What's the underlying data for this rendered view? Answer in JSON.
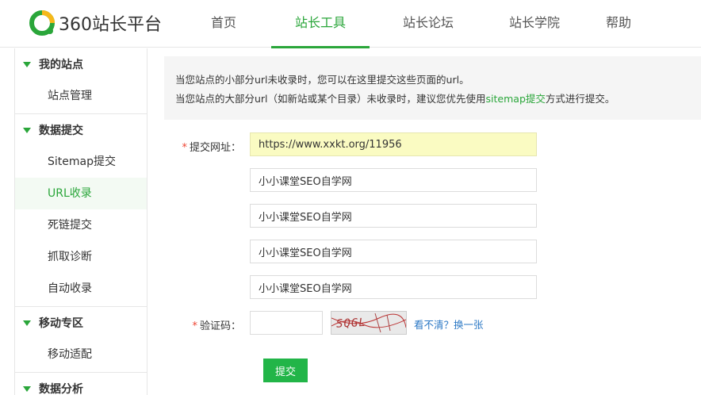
{
  "brand": {
    "name": "360站长平台",
    "accent": "#2aa63a"
  },
  "nav": {
    "items": [
      {
        "label": "首页",
        "active": false
      },
      {
        "label": "站长工具",
        "active": true
      },
      {
        "label": "站长论坛",
        "active": false
      },
      {
        "label": "站长学院",
        "active": false
      },
      {
        "label": "帮助",
        "active": false
      }
    ]
  },
  "sidebar": {
    "groups": [
      {
        "title": "我的站点",
        "items": [
          {
            "label": "站点管理",
            "active": false
          }
        ]
      },
      {
        "title": "数据提交",
        "items": [
          {
            "label": "Sitemap提交",
            "active": false
          },
          {
            "label": "URL收录",
            "active": true
          },
          {
            "label": "死链提交",
            "active": false
          },
          {
            "label": "抓取诊断",
            "active": false
          },
          {
            "label": "自动收录",
            "active": false
          }
        ]
      },
      {
        "title": "移动专区",
        "items": [
          {
            "label": "移动适配",
            "active": false
          }
        ]
      },
      {
        "title": "数据分析",
        "items": []
      }
    ]
  },
  "notice": {
    "line1": "当您站点的小部分url未收录时，您可以在这里提交这些页面的url。",
    "line2_prefix": "当您站点的大部分url（如新站或某个目录）未收录时，建议您优先使用",
    "line2_link": "sitemap提交",
    "line2_suffix": "方式进行提交。"
  },
  "form": {
    "required_mark": "*",
    "url_label": "提交网址：",
    "urls": [
      "https://www.xxkt.org/11956",
      "小小课堂SEO自学网",
      "小小课堂SEO自学网",
      "小小课堂SEO自学网",
      "小小课堂SEO自学网"
    ],
    "captcha_label": "验证码：",
    "captcha_text": "SQGL",
    "captcha_refresh": "看不清？换一张",
    "submit_label": "提交"
  }
}
